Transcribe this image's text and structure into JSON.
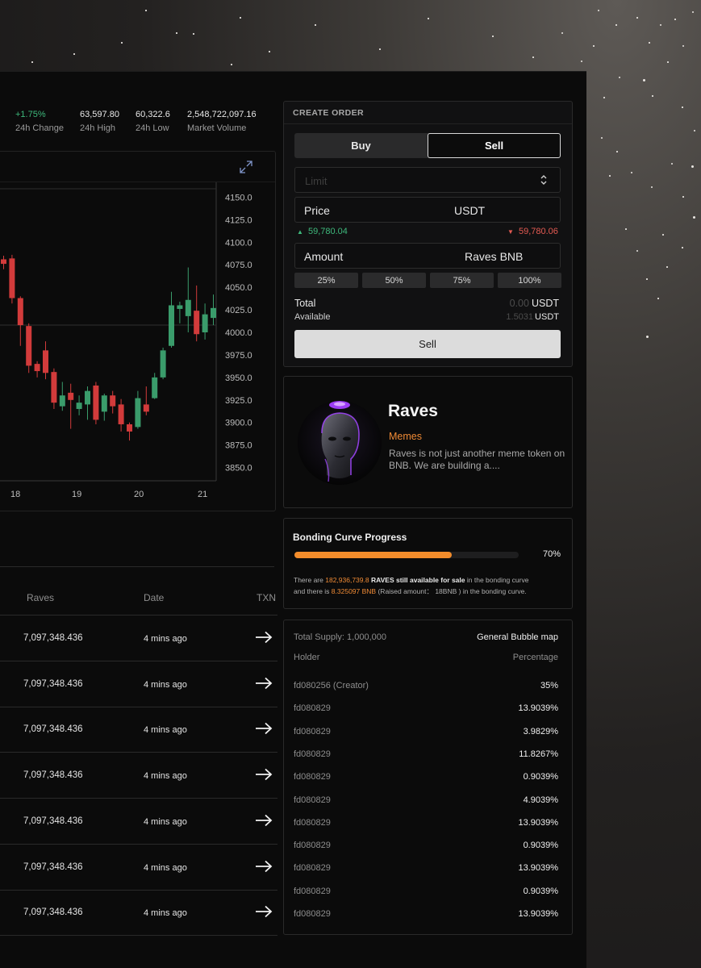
{
  "stats": [
    {
      "value": "+1.75%",
      "label": "24h Change"
    },
    {
      "value": "63,597.80",
      "label": "24h High"
    },
    {
      "value": "60,322.6",
      "label": "24h Low"
    },
    {
      "value": "2,548,722,097.16",
      "label": "Market Volume"
    }
  ],
  "chart_data": {
    "type": "candlestick",
    "y_ticks": [
      "4150.0",
      "4125.0",
      "4100.0",
      "4075.0",
      "4050.0",
      "4025.0",
      "4000.0",
      "3975.0",
      "3950.0",
      "3925.0",
      "3900.0",
      "3875.0",
      "3850.0"
    ],
    "ylim": [
      3840,
      4165
    ],
    "x_ticks": [
      "18",
      "19",
      "20",
      "21"
    ],
    "crosshair_y": 4008,
    "colors": {
      "up": "#3a9c6b",
      "down": "#d23b3b"
    },
    "candles": [
      {
        "o": 4081,
        "h": 4085,
        "l": 4070,
        "c": 4076
      },
      {
        "o": 4082,
        "h": 4086,
        "l": 4032,
        "c": 4038
      },
      {
        "o": 4038,
        "h": 4040,
        "l": 3985,
        "c": 4008
      },
      {
        "o": 4007,
        "h": 4010,
        "l": 3955,
        "c": 3963
      },
      {
        "o": 3965,
        "h": 3968,
        "l": 3950,
        "c": 3957
      },
      {
        "o": 3980,
        "h": 3990,
        "l": 3948,
        "c": 3955
      },
      {
        "o": 3956,
        "h": 3960,
        "l": 3915,
        "c": 3922
      },
      {
        "o": 3918,
        "h": 3945,
        "l": 3913,
        "c": 3930
      },
      {
        "o": 3933,
        "h": 3943,
        "l": 3893,
        "c": 3925
      },
      {
        "o": 3915,
        "h": 3930,
        "l": 3908,
        "c": 3922
      },
      {
        "o": 3920,
        "h": 3940,
        "l": 3903,
        "c": 3935
      },
      {
        "o": 3941,
        "h": 3945,
        "l": 3898,
        "c": 3903
      },
      {
        "o": 3912,
        "h": 3932,
        "l": 3902,
        "c": 3930
      },
      {
        "o": 3930,
        "h": 3935,
        "l": 3910,
        "c": 3918
      },
      {
        "o": 3920,
        "h": 3926,
        "l": 3890,
        "c": 3898
      },
      {
        "o": 3898,
        "h": 3900,
        "l": 3880,
        "c": 3890
      },
      {
        "o": 3895,
        "h": 3935,
        "l": 3893,
        "c": 3927
      },
      {
        "o": 3920,
        "h": 3940,
        "l": 3908,
        "c": 3912
      },
      {
        "o": 3927,
        "h": 3955,
        "l": 3926,
        "c": 3950
      },
      {
        "o": 3950,
        "h": 3983,
        "l": 3948,
        "c": 3980
      },
      {
        "o": 3985,
        "h": 4045,
        "l": 3983,
        "c": 4030
      },
      {
        "o": 4026,
        "h": 4034,
        "l": 4010,
        "c": 4030
      },
      {
        "o": 4018,
        "h": 4072,
        "l": 4000,
        "c": 4036
      },
      {
        "o": 4024,
        "h": 4052,
        "l": 3990,
        "c": 3998
      },
      {
        "o": 4000,
        "h": 4032,
        "l": 3992,
        "c": 4020
      },
      {
        "o": 4016,
        "h": 4042,
        "l": 4008,
        "c": 4027
      }
    ]
  },
  "trades": {
    "headers": {
      "raves": "Raves",
      "date": "Date",
      "txn": "TXN"
    },
    "rows": [
      {
        "amount": "7,097,348.436",
        "date": "4 mins ago"
      },
      {
        "amount": "7,097,348.436",
        "date": "4 mins ago"
      },
      {
        "amount": "7,097,348.436",
        "date": "4 mins ago"
      },
      {
        "amount": "7,097,348.436",
        "date": "4 mins ago"
      },
      {
        "amount": "7,097,348.436",
        "date": "4 mins ago"
      },
      {
        "amount": "7,097,348.436",
        "date": "4 mins ago"
      },
      {
        "amount": "7,097,348.436",
        "date": "4 mins ago"
      }
    ],
    "row_icon": "arrow-right-icon"
  },
  "order": {
    "title": "CREATE ORDER",
    "tab_buy": "Buy",
    "tab_sell": "Sell",
    "selected_tab": "Sell",
    "limit_placeholder": "Limit",
    "price_label": "Price",
    "price_unit": "USDT",
    "price_up": "59,780.04",
    "price_down": "59,780.06",
    "amount_label": "Amount",
    "amount_unit": "Raves BNB",
    "percent_buttons": [
      "25%",
      "50%",
      "75%",
      "100%"
    ],
    "total_label": "Total",
    "total_value": "0.00",
    "total_unit": "USDT",
    "available_label": "Available",
    "available_value": "1.5031",
    "available_unit": "USDT",
    "submit_label": "Sell"
  },
  "token": {
    "name": "Raves",
    "category": "Memes",
    "description": "Raves is not just another meme token on BNB. We are building a...."
  },
  "bonding": {
    "title": "Bonding Curve Progress",
    "progress": 0.7,
    "percent_text": "70%",
    "line1_pre": "There are",
    "line1_amount": "182,936,739.8",
    "line1_bold": "RAVES still available for sale",
    "line1_post": "in the bonding curve",
    "line2_pre": "and there is",
    "line2_amount": "8.325097 BNB",
    "line2_post": "(Raised amount： 18BNB ) in the bonding curve."
  },
  "holders": {
    "total_supply": "Total Supply: 1,000,000",
    "bubble_map": "General Bubble map",
    "col_holder": "Holder",
    "col_percentage": "Percentage",
    "rows": [
      {
        "address": "fd080256 (Creator)",
        "percentage": "35%"
      },
      {
        "address": "fd080829",
        "percentage": "13.9039%"
      },
      {
        "address": "fd080829",
        "percentage": "3.9829%"
      },
      {
        "address": "fd080829",
        "percentage": "11.8267%"
      },
      {
        "address": "fd080829",
        "percentage": "0.9039%"
      },
      {
        "address": "fd080829",
        "percentage": "4.9039%"
      },
      {
        "address": "fd080829",
        "percentage": "13.9039%"
      },
      {
        "address": "fd080829",
        "percentage": "0.9039%"
      },
      {
        "address": "fd080829",
        "percentage": "13.9039%"
      },
      {
        "address": "fd080829",
        "percentage": "0.9039%"
      },
      {
        "address": "fd080829",
        "percentage": "13.9039%"
      }
    ]
  }
}
